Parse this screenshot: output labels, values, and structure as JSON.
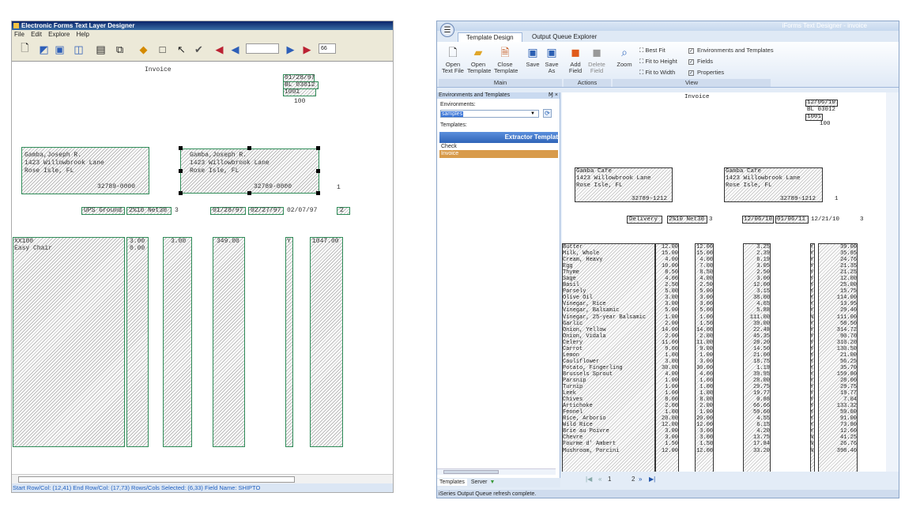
{
  "left": {
    "title": "Electronic Forms Text Layer Designer",
    "menu": [
      "File",
      "Edit",
      "Explore",
      "Help"
    ],
    "toolbar_input": "",
    "toolbar_zoom": "66",
    "heading": "Invoice",
    "date_fields": [
      "01/28/97",
      "BL 03012",
      "1001"
    ],
    "page_no": "100",
    "bill_to": [
      "Gamba,Joseph R.",
      "1423 Willowbrook Lane",
      "Rose Isle, FL",
      "32789-0000"
    ],
    "ship_to": [
      "Gamba,Joseph R.",
      "1423 Willowbrook Lane",
      "Rose Isle, FL",
      "32789-0000"
    ],
    "ship_to_num": "1",
    "ship_method": "UPS Ground",
    "terms": "2%10 Net30",
    "terms_num": "3",
    "order_date": "01/28/97",
    "due_date": "02/27/97",
    "inv_date": "02/07/97",
    "short_field": "2",
    "item_code": "XX100",
    "item_desc": "Easy Chair",
    "qty": "3.00",
    "qty2": "0.00",
    "shipped": "3.00",
    "price": "349.00",
    "tax": "Y",
    "amount": "1047.00",
    "status": "Start Row/Col: (12,41) End Row/Col: (17,73) Rows/Cols Selected: (6,33) Field Name: SHIPTO"
  },
  "right": {
    "title": "iForms Text Designer - invoice",
    "tabs": [
      "Template Design",
      "Output Queue Explorer"
    ],
    "main_buttons": [
      "Open Text File",
      "Open Template",
      "Close Template",
      "Save",
      "Save As"
    ],
    "main_label": "Main",
    "action_buttons": [
      "Add Field",
      "Delete Field"
    ],
    "actions_label": "Actions",
    "zoom_label": "Zoom",
    "view_items": [
      "Best Fit",
      "Fit to Height",
      "Fit to Width"
    ],
    "view_checks": [
      "Environments and Templates",
      "Fields",
      "Properties"
    ],
    "view_label": "View",
    "panel_title": "Environments and Templates",
    "panel_pin": "Ɱ ×",
    "env_label": "Environments:",
    "env_value": "samples",
    "tpl_label": "Templates:",
    "tpl_header": "Extractor Templat",
    "templates": [
      "Check",
      "Invoice"
    ],
    "bottom_tabs": [
      "Templates",
      "Server"
    ],
    "heading": "Invoice",
    "hdr_fields": [
      "12/06/10",
      "BL 03012",
      "1001"
    ],
    "page_no": "100",
    "bill_to": [
      "Gamba Cafe",
      "1423 Willowbrook Lane",
      "Rose Isle, FL",
      "32789-1212"
    ],
    "ship_to": [
      "Gamba Cafe",
      "1423 Willowbrook Lane",
      "Rose Isle, FL",
      "32789-1212"
    ],
    "ship_num": "1",
    "ship_method": "Delivery",
    "terms": "2%10 Net30",
    "terms_num": "3",
    "order_date": "12/06/10",
    "due_date": "01/06/11",
    "inv_date": "12/21/10",
    "inv_num": "3",
    "items": [
      "Butter",
      "Milk, Whole",
      "Cream, Heavy",
      "Egg",
      "Thyme",
      "Sage",
      "Basil",
      "Parsely",
      "Olive Oil",
      "Vinegar, Rice",
      "Vinegar, Balsamic",
      "Vinegar, 25-year Balsamic",
      "Garlic",
      "Onion, Yellow",
      "Onion, Vidala",
      "Celery",
      "Carrot",
      "Lemon",
      "Cauliflower",
      "Potato, Fingerling",
      "Brussels Sprout",
      "Parsnip",
      "Turnip",
      "Leek",
      "Chives",
      "Artichoke",
      "Fennel",
      "Rice, Arborio",
      "Wild Rice",
      "Brie au Poivre",
      "Chevre",
      "Fourme d' Ambert",
      "Mushroom, Porcini"
    ],
    "qty1": [
      "12.00",
      "15.00",
      "4.00",
      "10.00",
      "8.50",
      "4.00",
      "2.50",
      "5.00",
      "3.00",
      "3.00",
      "5.00",
      "1.00",
      "2.00",
      "14.00",
      "2.00",
      "11.00",
      "9.00",
      "1.00",
      "3.00",
      "30.00",
      "4.00",
      "1.00",
      "1.00",
      "1.00",
      "8.00",
      "2.00",
      "1.00",
      "20.00",
      "12.00",
      "3.00",
      "3.00",
      "1.50",
      "12.00"
    ],
    "qty2": [
      "12.00",
      "15.00",
      "4.00",
      "7.00",
      "8.50",
      "4.00",
      "2.50",
      "5.00",
      "3.00",
      "3.00",
      "5.00",
      "1.00",
      "1.50",
      "14.00",
      "2.00",
      "11.00",
      "9.00",
      "1.00",
      "3.00",
      "30.00",
      "4.00",
      "1.00",
      "1.00",
      "1.00",
      "8.00",
      "2.00",
      "1.00",
      "20.00",
      "12.00",
      "3.00",
      "3.00",
      "1.50",
      "12.00"
    ],
    "price": [
      "3.25",
      "2.39",
      "6.19",
      "3.05",
      "2.50",
      "3.00",
      "12.00",
      "3.15",
      "38.00",
      "4.65",
      "5.88",
      "111.00",
      "39.00",
      "22.48",
      "45.35",
      "28.20",
      "14.50",
      "21.00",
      "18.75",
      "1.19",
      "39.95",
      "28.00",
      "29.75",
      "19.77",
      "0.88",
      "66.66",
      "59.60",
      "4.55",
      "6.15",
      "4.20",
      "13.75",
      "17.84",
      "33.20"
    ],
    "tax": [
      "Y",
      "Y",
      "Y",
      "Y",
      "Y",
      "Y",
      "Y",
      "Y",
      "Y",
      "Y",
      "Y",
      "N",
      "Y",
      "Y",
      "Y",
      "Y",
      "Y",
      "Y",
      "Y",
      "Y",
      "Y",
      "Y",
      "Y",
      "Y",
      "Y",
      "Y",
      "Y",
      "Y",
      "Y",
      "Y",
      "N",
      "N",
      "N"
    ],
    "amount": [
      "39.00",
      "35.85",
      "24.76",
      "21.35",
      "21.25",
      "12.00",
      "25.00",
      "15.75",
      "114.00",
      "13.95",
      "29.40",
      "111.00",
      "58.50",
      "314.72",
      "90.70",
      "310.20",
      "130.50",
      "21.00",
      "56.25",
      "35.70",
      "159.80",
      "28.00",
      "29.75",
      "19.77",
      "7.04",
      "133.32",
      "59.60",
      "91.00",
      "73.80",
      "12.60",
      "41.25",
      "26.76",
      "398.40"
    ],
    "pager": [
      "1",
      "2"
    ],
    "status": "iSeries Output Queue refresh complete."
  }
}
